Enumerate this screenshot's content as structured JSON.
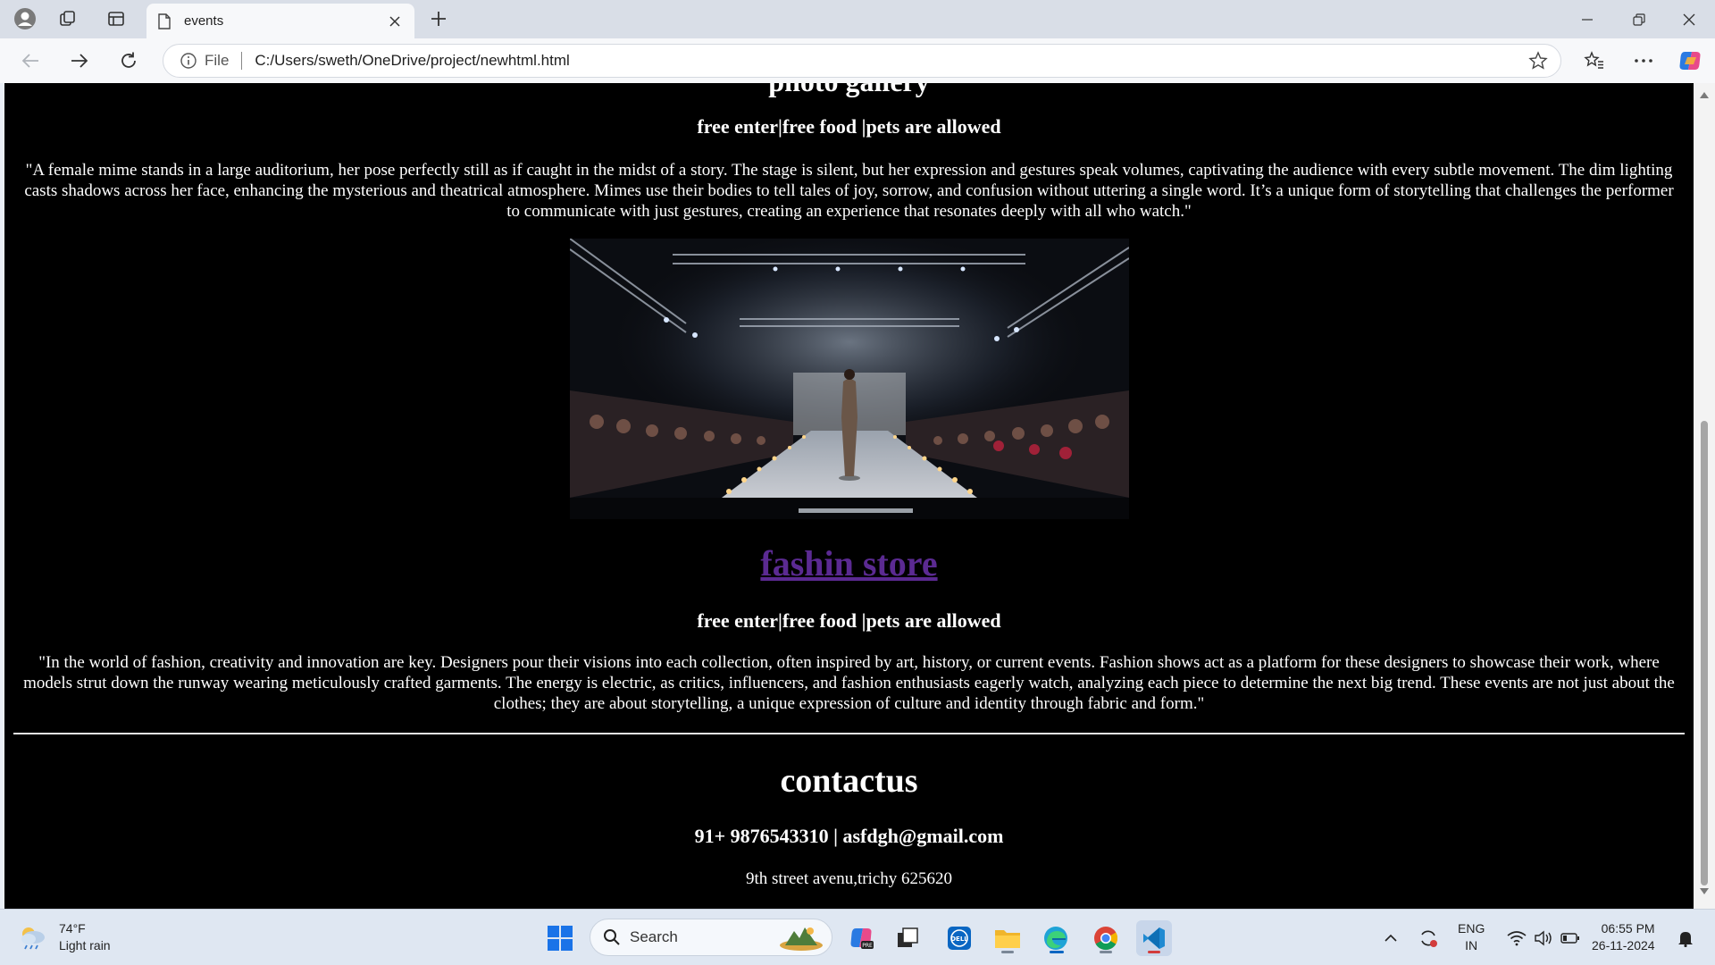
{
  "browser": {
    "tab_title": "events",
    "omnibox_scheme": "File",
    "url": "C:/Users/sweth/OneDrive/project/newhtml.html"
  },
  "page": {
    "cut_heading": "photo gallery",
    "section1": {
      "tagline": "free enter|free food |pets are allowed",
      "description": "\"A female mime stands in a large auditorium, her pose perfectly still as if caught in the midst of a story. The stage is silent, but her expression and gestures speak volumes, captivating the audience with every subtle movement. The dim lighting casts shadows across her face, enhancing the mysterious and theatrical atmosphere. Mimes use their bodies to tell tales of joy, sorrow, and confusion without uttering a single word. It’s a unique form of storytelling that challenges the performer to communicate with just gestures, creating an experience that resonates deeply with all who watch.\""
    },
    "section2": {
      "link_text": "fashin store",
      "tagline": "free enter|free food |pets are allowed",
      "description": "\"In the world of fashion, creativity and innovation are key. Designers pour their visions into each collection, often inspired by art, history, or current events. Fashion shows act as a platform for these designers to showcase their work, where models strut down the runway wearing meticulously crafted garments. The energy is electric, as critics, influencers, and fashion enthusiasts eagerly watch, analyzing each piece to determine the next big trend. These events are not just about the clothes; they are about storytelling, a unique expression of culture and identity through fabric and form.\""
    },
    "contact": {
      "heading": "contactus",
      "line": "91+ 9876543310 | asfdgh@gmail.com",
      "address": "9th street avenu,trichy 625620"
    },
    "colors": {
      "background": "#000000",
      "text": "#ffffff",
      "visited_link": "#5b2a92"
    }
  },
  "taskbar": {
    "weather_temp": "74°F",
    "weather_desc": "Light rain",
    "search_placeholder": "Search",
    "lang_top": "ENG",
    "lang_bottom": "IN",
    "time": "06:55 PM",
    "date": "26-11-2024",
    "pinned_icons": [
      "start-icon",
      "search-icon",
      "copilot-icon",
      "task-view-icon",
      "dell-icon",
      "file-explorer-icon",
      "edge-icon",
      "chrome-icon",
      "vscode-icon"
    ]
  }
}
